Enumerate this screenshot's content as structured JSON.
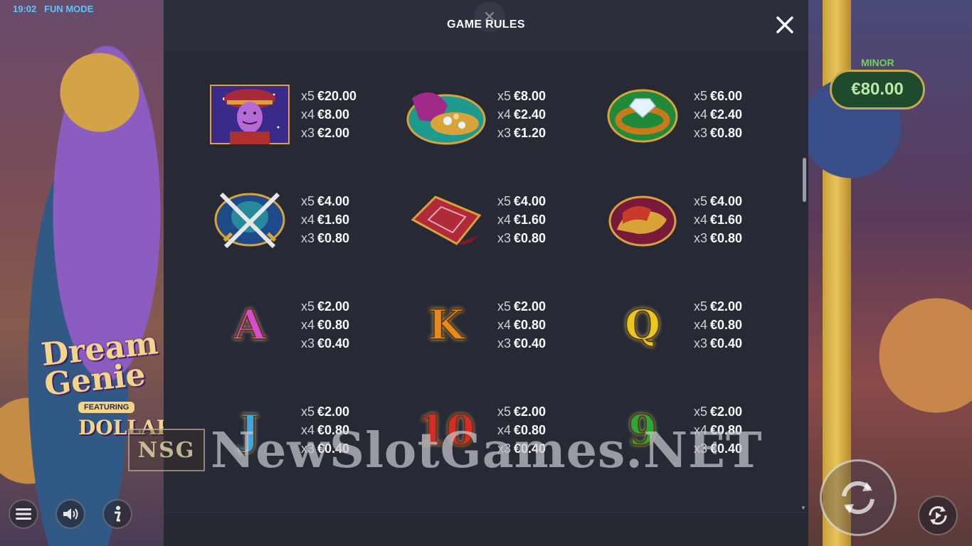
{
  "status": {
    "time": "19:02",
    "mode": "FUN MODE"
  },
  "background": {
    "logo_line1": "Dream",
    "logo_line2": "Genie",
    "logo_featuring": "FEATURING",
    "logo_sub": "DOLLAR",
    "jackpot_label": "MINOR",
    "jackpot_value": "€80.00"
  },
  "modal": {
    "title": "GAME RULES",
    "close_icon": "close-icon"
  },
  "paytable": [
    {
      "symbol": "genie-portrait",
      "pays": [
        [
          "x5",
          "€20.00"
        ],
        [
          "x4",
          "€8.00"
        ],
        [
          "x3",
          "€2.00"
        ]
      ]
    },
    {
      "symbol": "treasure-bag",
      "pays": [
        [
          "x5",
          "€8.00"
        ],
        [
          "x4",
          "€2.40"
        ],
        [
          "x3",
          "€1.20"
        ]
      ]
    },
    {
      "symbol": "diamond-ring",
      "pays": [
        [
          "x5",
          "€6.00"
        ],
        [
          "x4",
          "€2.40"
        ],
        [
          "x3",
          "€0.80"
        ]
      ]
    },
    {
      "symbol": "crossed-swords",
      "pays": [
        [
          "x5",
          "€4.00"
        ],
        [
          "x4",
          "€1.60"
        ],
        [
          "x3",
          "€0.80"
        ]
      ]
    },
    {
      "symbol": "magic-carpet",
      "pays": [
        [
          "x5",
          "€4.00"
        ],
        [
          "x4",
          "€1.60"
        ],
        [
          "x3",
          "€0.80"
        ]
      ]
    },
    {
      "symbol": "slippers",
      "pays": [
        [
          "x5",
          "€4.00"
        ],
        [
          "x4",
          "€1.60"
        ],
        [
          "x3",
          "€0.80"
        ]
      ]
    },
    {
      "symbol": "letter-a",
      "letter": "A",
      "pays": [
        [
          "x5",
          "€2.00"
        ],
        [
          "x4",
          "€0.80"
        ],
        [
          "x3",
          "€0.40"
        ]
      ]
    },
    {
      "symbol": "letter-k",
      "letter": "K",
      "pays": [
        [
          "x5",
          "€2.00"
        ],
        [
          "x4",
          "€0.80"
        ],
        [
          "x3",
          "€0.40"
        ]
      ]
    },
    {
      "symbol": "letter-q",
      "letter": "Q",
      "pays": [
        [
          "x5",
          "€2.00"
        ],
        [
          "x4",
          "€0.80"
        ],
        [
          "x3",
          "€0.40"
        ]
      ]
    },
    {
      "symbol": "letter-j",
      "letter": "J",
      "pays": [
        [
          "x5",
          "€2.00"
        ],
        [
          "x4",
          "€0.80"
        ],
        [
          "x3",
          "€0.40"
        ]
      ]
    },
    {
      "symbol": "number-10",
      "letter": "10",
      "pays": [
        [
          "x5",
          "€2.00"
        ],
        [
          "x4",
          "€0.80"
        ],
        [
          "x3",
          "€0.40"
        ]
      ]
    },
    {
      "symbol": "number-9",
      "letter": "9",
      "pays": [
        [
          "x5",
          "€2.00"
        ],
        [
          "x4",
          "€0.80"
        ],
        [
          "x3",
          "€0.40"
        ]
      ]
    }
  ],
  "controls": {
    "menu_icon": "menu-icon",
    "sound_icon": "sound-icon",
    "info_icon": "info-icon",
    "spin_icon": "spin-icon",
    "autoplay_icon": "autoplay-icon"
  },
  "watermark": {
    "box_text": "NSG",
    "text": "NewSlotGames.NET"
  },
  "colors": {
    "modal_bg": "#272a35",
    "header_bg": "#2b2e3b",
    "jackpot_green": "#74d25a",
    "status_blue": "#5cc4ff"
  }
}
